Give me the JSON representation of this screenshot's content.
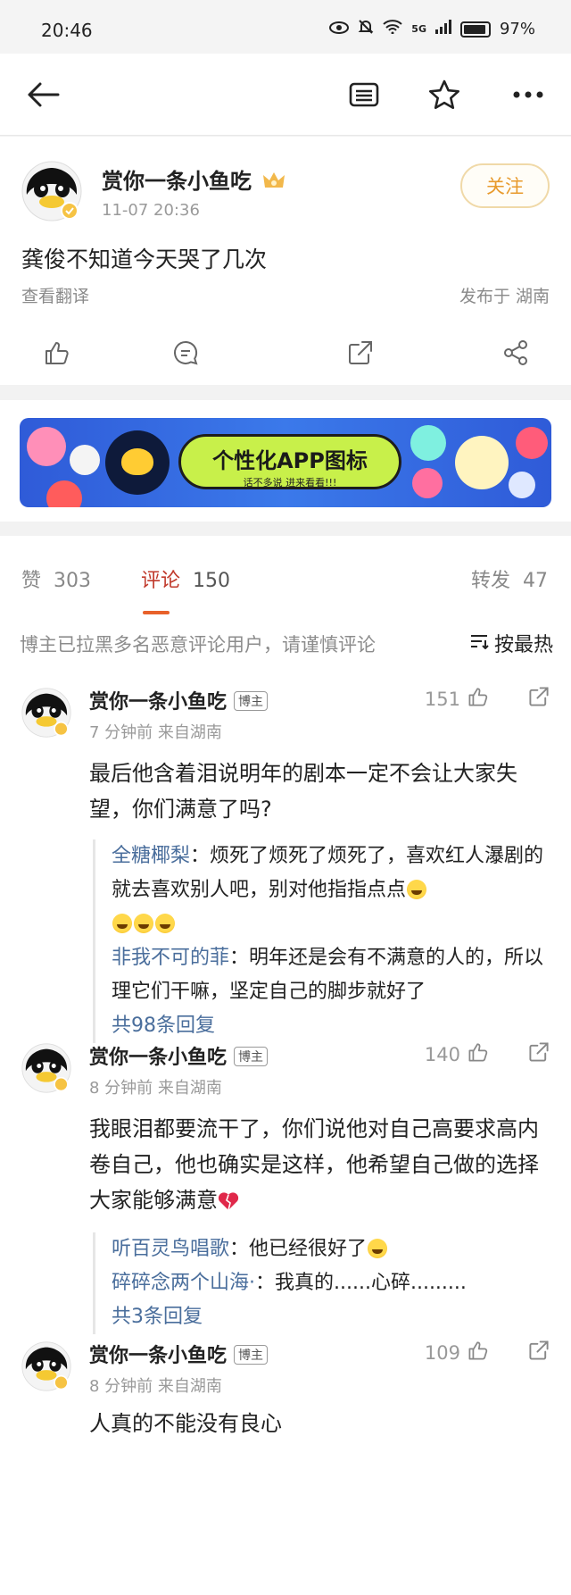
{
  "status_bar": {
    "time": "20:46",
    "signal": "5G",
    "battery": "97%"
  },
  "post": {
    "username": "赏你一条小鱼吃",
    "timestamp": "11-07 20:36",
    "follow_label": "关注",
    "content": "龚俊不知道今天哭了几次",
    "translate_label": "查看翻译",
    "location": "发布于 湖南"
  },
  "banner": {
    "title": "个性化APP图标",
    "subtitle": "话不多说 进来看看!!!"
  },
  "stats": {
    "likes_label": "赞",
    "likes_count": "303",
    "comments_label": "评论",
    "comments_count": "150",
    "reposts_label": "转发",
    "reposts_count": "47"
  },
  "notice": {
    "text": "博主已拉黑多名恶意评论用户，请谨慎评论",
    "sort_label": "按最热"
  },
  "comments": [
    {
      "username": "赏你一条小鱼吃",
      "badge": "博主",
      "likes": "151",
      "meta": "7 分钟前   来自湖南",
      "text": "最后他含着泪说明年的剧本一定不会让大家失望，你们满意了吗?",
      "replies": [
        {
          "who": "全糖椰梨",
          "text": "：烦死了烦死了烦死了，喜欢红人瀑剧的就去喜欢别人吧，别对他指指点点"
        },
        {
          "who": "非我不可的菲",
          "text": "：明年还是会有不满意的人的，所以理它们干嘛，坚定自己的脚步就好了"
        }
      ],
      "more": "共98条回复"
    },
    {
      "username": "赏你一条小鱼吃",
      "badge": "博主",
      "likes": "140",
      "meta": "8 分钟前   来自湖南",
      "text": "我眼泪都要流干了，你们说他对自己高要求高内卷自己，他也确实是这样，他希望自己做的选择大家能够满意",
      "replies": [
        {
          "who": "听百灵鸟唱歌",
          "text": "：他已经很好了"
        },
        {
          "who": "碎碎念两个山海·",
          "text": "：我真的......心碎........."
        }
      ],
      "more": "共3条回复"
    },
    {
      "username": "赏你一条小鱼吃",
      "badge": "博主",
      "likes": "109",
      "meta": "8 分钟前   来自湖南",
      "text": "人真的不能没有良心"
    }
  ]
}
